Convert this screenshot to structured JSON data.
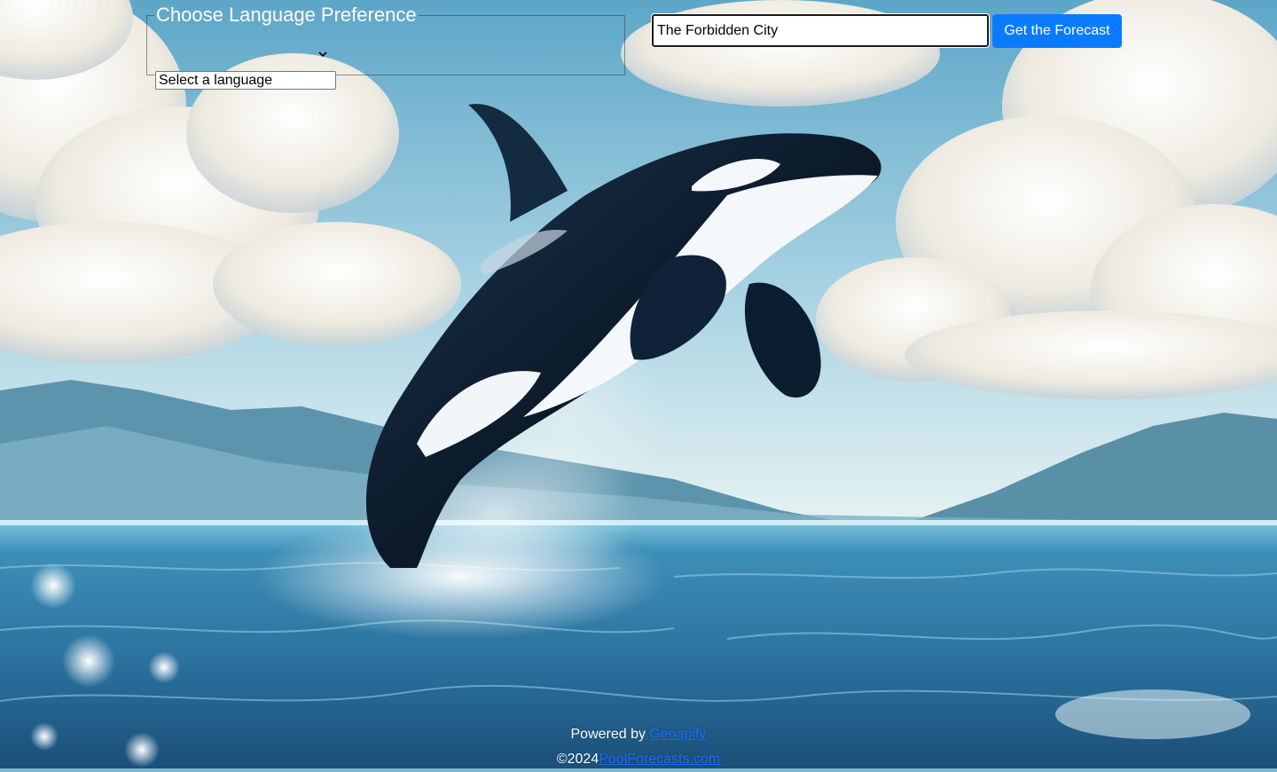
{
  "language": {
    "legend": "Choose Language Preference",
    "select_value": "Select a language",
    "options": [
      "Select a language"
    ]
  },
  "search": {
    "value": "The Forbidden City",
    "button_label": "Get the Forecast"
  },
  "footer": {
    "powered_by": "Powered by",
    "powered_link": "Geoapify",
    "copyright": "©2024",
    "site_link": "PoolForecasts.com"
  },
  "scene": {
    "subject": "orca-whale",
    "colors": {
      "sky_top": "#6fb0cf",
      "cloud": "#f6f3ea",
      "mountain": "#5f96b0",
      "sea": "#2f7aa5",
      "sea_deep": "#1b5880",
      "button": "#0a7bff",
      "link": "#1e6bff"
    }
  }
}
